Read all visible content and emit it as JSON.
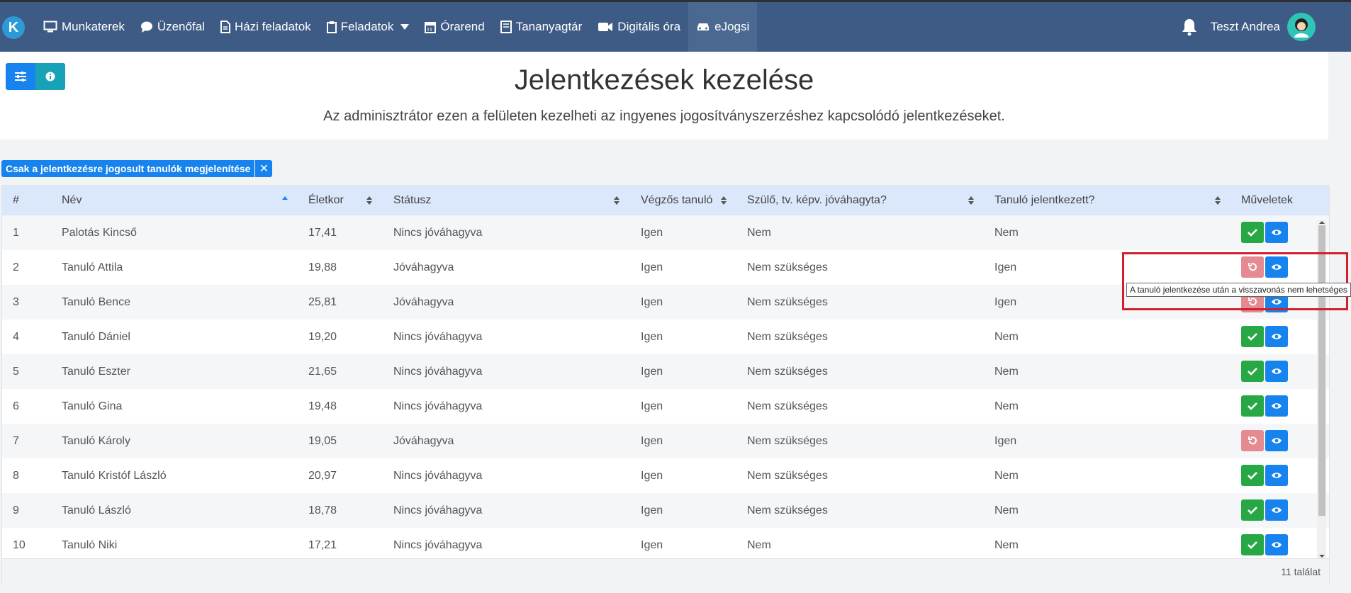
{
  "nav": {
    "logo_letter": "K",
    "items": [
      {
        "label": "Munkaterek",
        "icon": "monitor-icon"
      },
      {
        "label": "Üzenőfal",
        "icon": "chat-bubble-icon"
      },
      {
        "label": "Házi feladatok",
        "icon": "document-icon"
      },
      {
        "label": "Feladatok",
        "icon": "clipboard-icon"
      },
      {
        "label": "Órarend",
        "icon": "calendar-icon"
      },
      {
        "label": "Tananyagtár",
        "icon": "book-icon"
      },
      {
        "label": "Digitális óra",
        "icon": "video-camera-icon"
      },
      {
        "label": "eJogsi",
        "icon": "car-icon",
        "active": true
      }
    ],
    "user_name": "Teszt Andrea"
  },
  "header": {
    "title": "Jelentkezések kezelése",
    "subtitle": "Az adminisztrátor ezen a felületen kezelheti az ingyenes jogosítványszerzéshez kapcsolódó jelentkezéseket."
  },
  "filter": {
    "label": "Csak a jelentkezésre jogosult tanulók megjelenítése",
    "close": "✕"
  },
  "table": {
    "columns": [
      "#",
      "Név",
      "Életkor",
      "Státusz",
      "Végzős tanuló",
      "Szülő, tv. képv. jóváhagyta?",
      "Tanuló jelentkezett?",
      "Műveletek"
    ],
    "rows": [
      {
        "num": "1",
        "name": "Palotás Kincső",
        "age": "17,41",
        "status": "Nincs jóváhagyva",
        "senior": "Igen",
        "parent": "Nem",
        "applied": "Nem",
        "action": "approve"
      },
      {
        "num": "2",
        "name": "Tanuló Attila",
        "age": "19,88",
        "status": "Jóváhagyva",
        "senior": "Igen",
        "parent": "Nem szükséges",
        "applied": "Igen",
        "action": "undo"
      },
      {
        "num": "3",
        "name": "Tanuló Bence",
        "age": "25,81",
        "status": "Jóváhagyva",
        "senior": "Igen",
        "parent": "Nem szükséges",
        "applied": "Igen",
        "action": "undo"
      },
      {
        "num": "4",
        "name": "Tanuló Dániel",
        "age": "19,20",
        "status": "Nincs jóváhagyva",
        "senior": "Igen",
        "parent": "Nem szükséges",
        "applied": "Nem",
        "action": "approve"
      },
      {
        "num": "5",
        "name": "Tanuló Eszter",
        "age": "21,65",
        "status": "Nincs jóváhagyva",
        "senior": "Igen",
        "parent": "Nem szükséges",
        "applied": "Nem",
        "action": "approve"
      },
      {
        "num": "6",
        "name": "Tanuló Gina",
        "age": "19,48",
        "status": "Nincs jóváhagyva",
        "senior": "Igen",
        "parent": "Nem szükséges",
        "applied": "Nem",
        "action": "approve"
      },
      {
        "num": "7",
        "name": "Tanuló Károly",
        "age": "19,05",
        "status": "Jóváhagyva",
        "senior": "Igen",
        "parent": "Nem szükséges",
        "applied": "Igen",
        "action": "undo"
      },
      {
        "num": "8",
        "name": "Tanuló Kristóf László",
        "age": "20,97",
        "status": "Nincs jóváhagyva",
        "senior": "Igen",
        "parent": "Nem szükséges",
        "applied": "Nem",
        "action": "approve"
      },
      {
        "num": "9",
        "name": "Tanuló László",
        "age": "18,78",
        "status": "Nincs jóváhagyva",
        "senior": "Igen",
        "parent": "Nem szükséges",
        "applied": "Nem",
        "action": "approve"
      },
      {
        "num": "10",
        "name": "Tanuló Niki",
        "age": "17,21",
        "status": "Nincs jóváhagyva",
        "senior": "Igen",
        "parent": "Nem",
        "applied": "Nem",
        "action": "approve"
      }
    ],
    "result_count": "11 találat"
  },
  "tooltip": "A tanuló jelentkezése után a visszavonás nem lehetséges",
  "colors": {
    "navbar": "#3e5b86",
    "primary": "#1683ee",
    "success": "#28a745",
    "undo_disabled": "#e58a90",
    "highlight": "#d11f2d"
  }
}
